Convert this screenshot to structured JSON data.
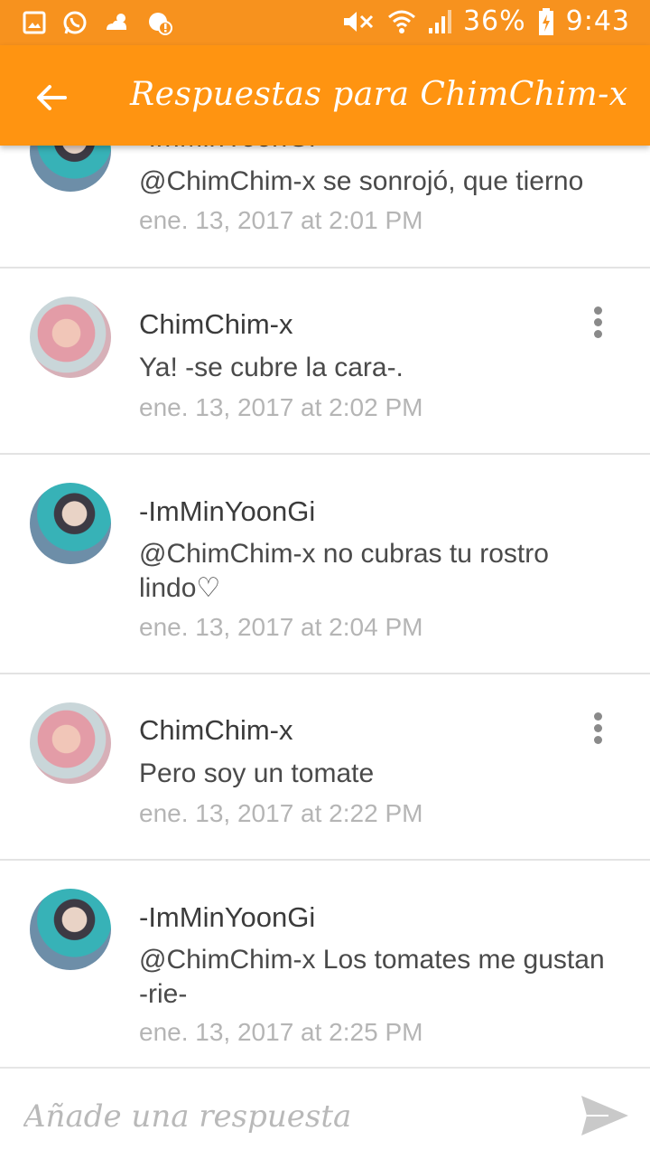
{
  "status_bar": {
    "icons_left": [
      "gallery-icon",
      "whatsapp-icon",
      "weather-icon",
      "app-notification-icon"
    ],
    "icons_right": [
      "mute-icon",
      "wifi-icon",
      "signal-icon",
      "battery-charging-icon"
    ],
    "battery_percent": "36%",
    "time": "9:43"
  },
  "appbar": {
    "title": "Respuestas para ChimChim-x"
  },
  "replies": [
    {
      "user": "-ImMinYoonGi",
      "text": "@ChimChim-x  se sonrojó, que tierno",
      "time": "ene. 13, 2017 at 2:01 PM"
    },
    {
      "user": "ChimChim-x",
      "text": "Ya! -se cubre la cara-.",
      "time": "ene. 13, 2017 at 2:02 PM"
    },
    {
      "user": "-ImMinYoonGi",
      "text": "@ChimChim-x  no cubras tu rostro lindo♡",
      "time": "ene. 13, 2017 at 2:04 PM"
    },
    {
      "user": "ChimChim-x",
      "text": "Pero soy un tomate",
      "time": "ene. 13, 2017 at 2:22 PM"
    },
    {
      "user": "-ImMinYoonGi",
      "text": "@ChimChim-x  Los tomates me gustan -rie-",
      "time": "ene. 13, 2017 at 2:25 PM"
    }
  ],
  "composer": {
    "placeholder": "Añade una respuesta"
  },
  "colors": {
    "status_bar": "#F7921E",
    "app_bar": "#FF9411",
    "timestamp": "#B5B5B5"
  }
}
